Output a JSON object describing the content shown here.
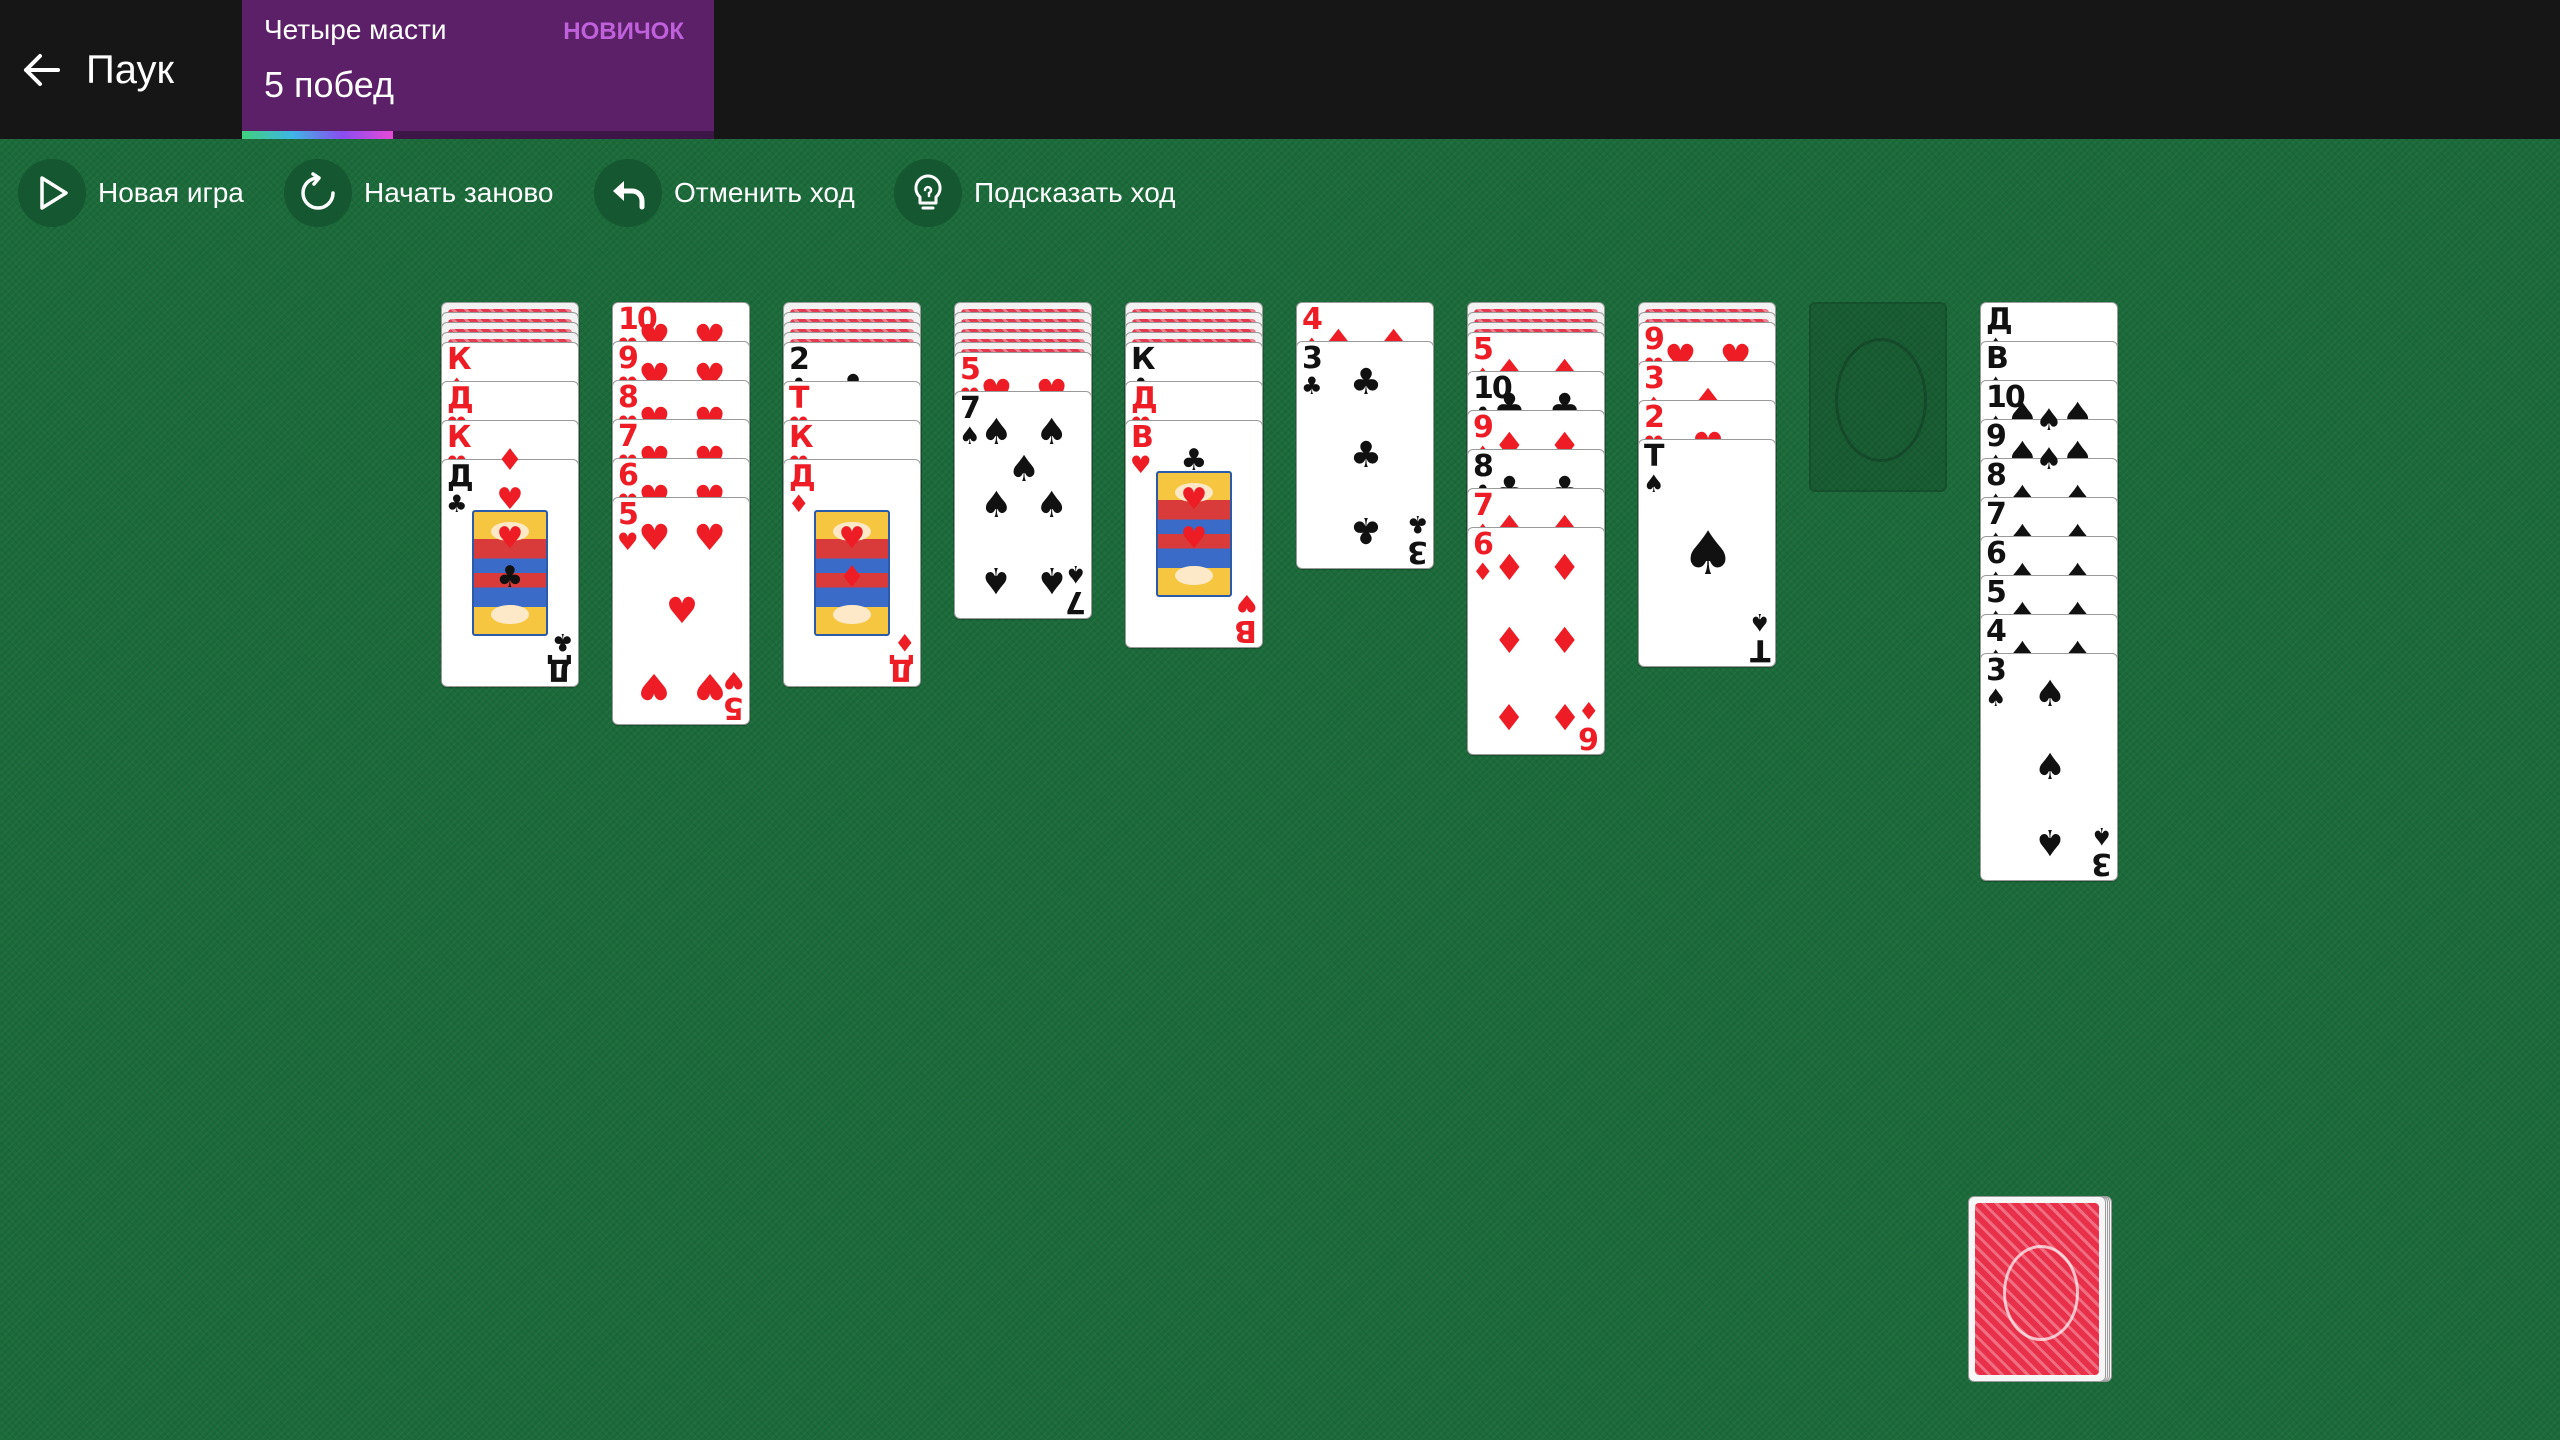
{
  "header": {
    "back_label": "Паук"
  },
  "mode": {
    "name": "Четыре масти",
    "level": "НОВИЧОК",
    "wins": "5 побед",
    "progress": 0.32
  },
  "toolbar": {
    "new_game": "Новая игра",
    "restart": "Начать заново",
    "undo": "Отменить ход",
    "hint": "Подсказать ход"
  },
  "colors": {
    "felt": "#1b6a3a",
    "topbar": "#161616",
    "mode_panel": "#5c2068",
    "level": "#c061dc",
    "red_suit": "#ee1c25",
    "black_suit": "#111111"
  },
  "suits": {
    "hearts": "♥",
    "diamonds": "♦",
    "clubs": "♣",
    "spades": "♠"
  },
  "tableau": [
    {
      "down": 4,
      "up": [
        {
          "rank": "К",
          "suit": "diamonds"
        },
        {
          "rank": "Д",
          "suit": "hearts"
        },
        {
          "rank": "К",
          "suit": "hearts"
        },
        {
          "rank": "Д",
          "suit": "clubs"
        }
      ]
    },
    {
      "down": 0,
      "up": [
        {
          "rank": "10",
          "suit": "hearts"
        },
        {
          "rank": "9",
          "suit": "hearts"
        },
        {
          "rank": "8",
          "suit": "hearts"
        },
        {
          "rank": "7",
          "suit": "hearts"
        },
        {
          "rank": "6",
          "suit": "hearts"
        },
        {
          "rank": "5",
          "suit": "hearts"
        }
      ]
    },
    {
      "down": 4,
      "up": [
        {
          "rank": "2",
          "suit": "clubs"
        },
        {
          "rank": "Т",
          "suit": "hearts"
        },
        {
          "rank": "К",
          "suit": "hearts"
        },
        {
          "rank": "Д",
          "suit": "diamonds"
        }
      ]
    },
    {
      "down": 5,
      "up": [
        {
          "rank": "5",
          "suit": "hearts"
        },
        {
          "rank": "7",
          "suit": "spades"
        }
      ]
    },
    {
      "down": 4,
      "up": [
        {
          "rank": "К",
          "suit": "clubs"
        },
        {
          "rank": "Д",
          "suit": "hearts"
        },
        {
          "rank": "В",
          "suit": "hearts"
        }
      ]
    },
    {
      "down": 0,
      "up": [
        {
          "rank": "4",
          "suit": "diamonds"
        },
        {
          "rank": "3",
          "suit": "clubs"
        }
      ]
    },
    {
      "down": 3,
      "up": [
        {
          "rank": "5",
          "suit": "diamonds"
        },
        {
          "rank": "10",
          "suit": "clubs"
        },
        {
          "rank": "9",
          "suit": "diamonds"
        },
        {
          "rank": "8",
          "suit": "clubs"
        },
        {
          "rank": "7",
          "suit": "diamonds"
        },
        {
          "rank": "6",
          "suit": "diamonds"
        }
      ]
    },
    {
      "down": 2,
      "up": [
        {
          "rank": "9",
          "suit": "hearts"
        },
        {
          "rank": "3",
          "suit": "diamonds"
        },
        {
          "rank": "2",
          "suit": "hearts"
        },
        {
          "rank": "Т",
          "suit": "spades"
        }
      ]
    },
    {
      "down": 0,
      "up": [],
      "empty": true
    },
    {
      "down": 0,
      "up": [
        {
          "rank": "Д",
          "suit": "spades"
        },
        {
          "rank": "В",
          "suit": "spades"
        },
        {
          "rank": "10",
          "suit": "spades"
        },
        {
          "rank": "9",
          "suit": "spades"
        },
        {
          "rank": "8",
          "suit": "spades"
        },
        {
          "rank": "7",
          "suit": "spades"
        },
        {
          "rank": "6",
          "suit": "spades"
        },
        {
          "rank": "5",
          "suit": "spades"
        },
        {
          "rank": "4",
          "suit": "spades"
        },
        {
          "rank": "3",
          "suit": "spades"
        }
      ]
    }
  ],
  "stock": {
    "piles": 4
  }
}
